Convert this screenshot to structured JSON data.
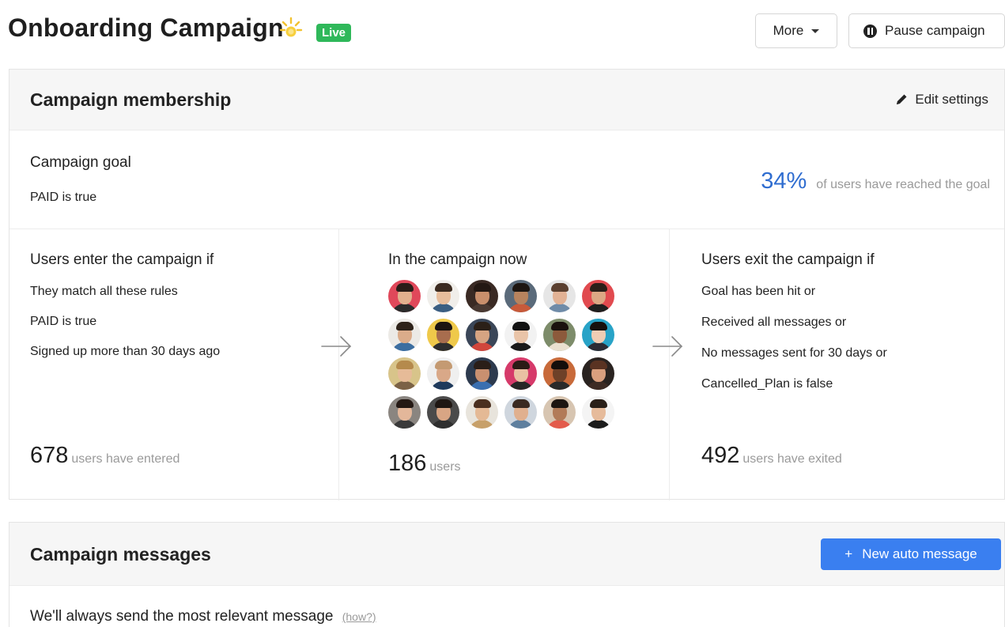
{
  "header": {
    "title": "Onboarding Campaign",
    "status_badge": "Live",
    "more_label": "More",
    "pause_label": "Pause campaign"
  },
  "membership": {
    "title": "Campaign membership",
    "edit_label": "Edit settings",
    "goal": {
      "title": "Campaign goal",
      "rule": "PAID is true",
      "percent": "34%",
      "percent_text": "of users have reached the goal"
    },
    "enter": {
      "title": "Users enter the campaign if",
      "rules": [
        "They match all these rules",
        "PAID is true",
        "Signed up more than 30 days ago"
      ],
      "count": "678",
      "count_text": "users have entered"
    },
    "now": {
      "title": "In the campaign now",
      "count": "186",
      "count_text": "users",
      "avatars": [
        {
          "bg": "#e0485a",
          "skin": "#e2b08e",
          "hair": "#2a1d18",
          "shirt": "#2b2b2b"
        },
        {
          "bg": "#f0eeea",
          "skin": "#e7bd9c",
          "hair": "#3b2a20",
          "shirt": "#3b5e82"
        },
        {
          "bg": "#3a2a24",
          "skin": "#c98f6c",
          "hair": "#231813",
          "shirt": "#4a3a33"
        },
        {
          "bg": "#5a6a7a",
          "skin": "#b7835e",
          "hair": "#1d1612",
          "shirt": "#c85a3a"
        },
        {
          "bg": "#e6e6e6",
          "skin": "#e2b295",
          "hair": "#5b4030",
          "shirt": "#6f8ba8"
        },
        {
          "bg": "#e14a4f",
          "skin": "#dca784",
          "hair": "#2b1f19",
          "shirt": "#1f1f1f"
        },
        {
          "bg": "#eceae6",
          "skin": "#dbac8a",
          "hair": "#2d2219",
          "shirt": "#3c6ea0"
        },
        {
          "bg": "#efc94a",
          "skin": "#a86d4e",
          "hair": "#1c1410",
          "shirt": "#2e2e2e"
        },
        {
          "bg": "#3a4658",
          "skin": "#d6a482",
          "hair": "#2b2018",
          "shirt": "#d0463c"
        },
        {
          "bg": "#f2f2f2",
          "skin": "#e9c4a8",
          "hair": "#111111",
          "shirt": "#1a1a1a"
        },
        {
          "bg": "#7d8c6a",
          "skin": "#8c5a3c",
          "hair": "#1a120e",
          "shirt": "#e9e0cf"
        },
        {
          "bg": "#28a3c7",
          "skin": "#efcdb4",
          "hair": "#16100d",
          "shirt": "#2c2c34"
        },
        {
          "bg": "#d8c48a",
          "skin": "#e6bb98",
          "hair": "#b58a4c",
          "shirt": "#7b6246"
        },
        {
          "bg": "#efefef",
          "skin": "#d9a888",
          "hair": "#c49a72",
          "shirt": "#1f3a5c"
        },
        {
          "bg": "#2d3a4e",
          "skin": "#c99070",
          "hair": "#2a1e18",
          "shirt": "#3a6fb0"
        },
        {
          "bg": "#d63a6a",
          "skin": "#e9c1a3",
          "hair": "#2a1b16",
          "shirt": "#262626"
        },
        {
          "bg": "#c86a3a",
          "skin": "#6e4128",
          "hair": "#140e0b",
          "shirt": "#2a2a2a"
        },
        {
          "bg": "#2a2320",
          "skin": "#d99f7e",
          "hair": "#5a3322",
          "shirt": "#3d2b24"
        },
        {
          "bg": "#8a8580",
          "skin": "#e3b79a",
          "hair": "#241914",
          "shirt": "#3a3a3a"
        },
        {
          "bg": "#4a4a4a",
          "skin": "#d8a584",
          "hair": "#1f1713",
          "shirt": "#2f2f2f"
        },
        {
          "bg": "#e8e4dc",
          "skin": "#e4b995",
          "hair": "#4a2f1f",
          "shirt": "#c7a06a"
        },
        {
          "bg": "#cfd6de",
          "skin": "#e0b08f",
          "hair": "#3a2a22",
          "shirt": "#5e7f9e"
        },
        {
          "bg": "#d7c5b1",
          "skin": "#b27b58",
          "hair": "#1d1511",
          "shirt": "#e35b4b"
        },
        {
          "bg": "#f4f4f4",
          "skin": "#e6bb9b",
          "hair": "#2a2019",
          "shirt": "#1c1c1c"
        }
      ]
    },
    "exit": {
      "title": "Users exit the campaign if",
      "rules": [
        "Goal has been hit or",
        "Received all messages or",
        "No messages sent for 30 days or",
        "Cancelled_Plan is false"
      ],
      "count": "492",
      "count_text": "users have exited"
    }
  },
  "messages": {
    "title": "Campaign messages",
    "new_button_label": "New auto message",
    "relevant_text": "We'll always send the most relevant message",
    "how_link": "(how?)"
  },
  "colors": {
    "accent_blue": "#2f6dd0",
    "button_blue": "#3a7ff0",
    "live_green": "#2fb85a"
  }
}
